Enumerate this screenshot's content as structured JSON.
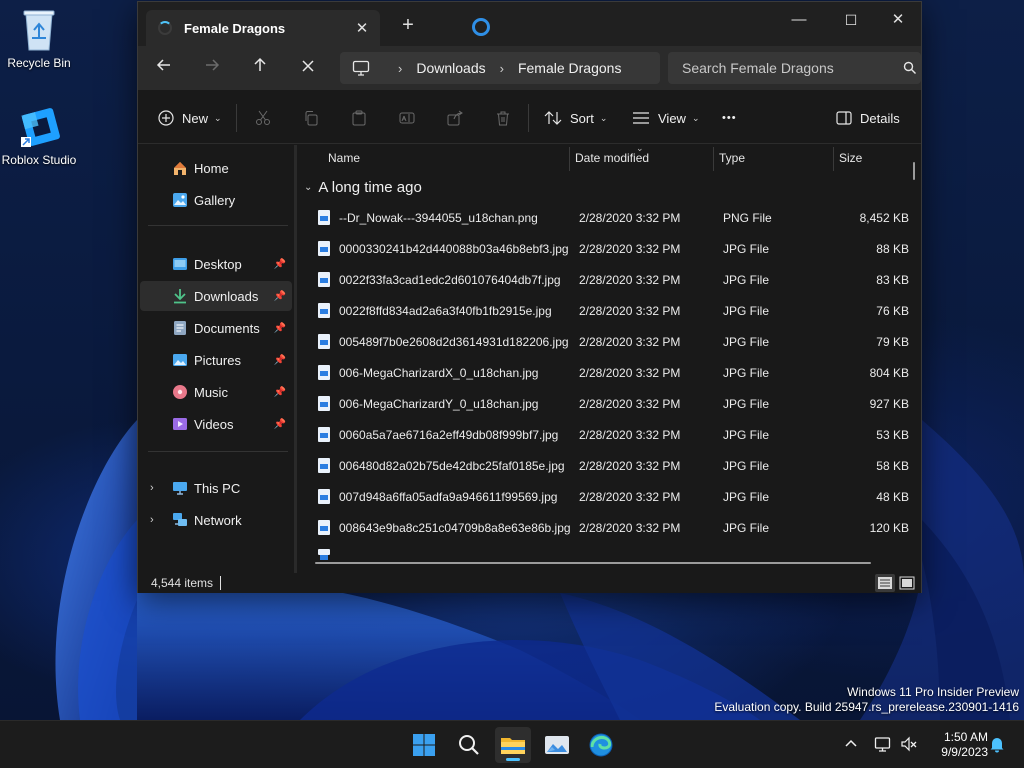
{
  "desktop": {
    "icons": [
      {
        "label": "Recycle Bin",
        "icon": "recycle-bin-icon"
      },
      {
        "label": "Roblox Studio",
        "icon": "roblox-studio-icon"
      }
    ]
  },
  "window": {
    "tab_title": "Female Dragons",
    "tab_close": "✕",
    "new_tab": "+",
    "controls": {
      "minimize": "—",
      "maximize": "☐",
      "close": "✕"
    },
    "breadcrumbs": [
      "Downloads",
      "Female Dragons"
    ],
    "breadcrumb_sep": "›",
    "search_placeholder": "Search Female Dragons",
    "toolbar": {
      "new_label": "New",
      "sort_label": "Sort",
      "view_label": "View",
      "more_label": "•••",
      "details_label": "Details"
    },
    "nav": {
      "home": "Home",
      "gallery": "Gallery",
      "desktop": "Desktop",
      "downloads": "Downloads",
      "documents": "Documents",
      "pictures": "Pictures",
      "music": "Music",
      "videos": "Videos",
      "this_pc": "This PC",
      "network": "Network"
    },
    "columns": {
      "name": "Name",
      "date": "Date modified",
      "type": "Type",
      "size": "Size"
    },
    "group_header": "A long time ago",
    "files": [
      {
        "name": "--Dr_Nowak---3944055_u18chan.png",
        "date": "2/28/2020 3:32 PM",
        "type": "PNG File",
        "size": "8,452 KB"
      },
      {
        "name": "0000330241b42d440088b03a46b8ebf3.jpg",
        "date": "2/28/2020 3:32 PM",
        "type": "JPG File",
        "size": "88 KB"
      },
      {
        "name": "0022f33fa3cad1edc2d601076404db7f.jpg",
        "date": "2/28/2020 3:32 PM",
        "type": "JPG File",
        "size": "83 KB"
      },
      {
        "name": "0022f8ffd834ad2a6a3f40fb1fb2915e.jpg",
        "date": "2/28/2020 3:32 PM",
        "type": "JPG File",
        "size": "76 KB"
      },
      {
        "name": "005489f7b0e2608d2d3614931d182206.jpg",
        "date": "2/28/2020 3:32 PM",
        "type": "JPG File",
        "size": "79 KB"
      },
      {
        "name": "006-MegaCharizardX_0_u18chan.jpg",
        "date": "2/28/2020 3:32 PM",
        "type": "JPG File",
        "size": "804 KB"
      },
      {
        "name": "006-MegaCharizardY_0_u18chan.jpg",
        "date": "2/28/2020 3:32 PM",
        "type": "JPG File",
        "size": "927 KB"
      },
      {
        "name": "0060a5a7ae6716a2eff49db08f999bf7.jpg",
        "date": "2/28/2020 3:32 PM",
        "type": "JPG File",
        "size": "53 KB"
      },
      {
        "name": "006480d82a02b75de42dbc25faf0185e.jpg",
        "date": "2/28/2020 3:32 PM",
        "type": "JPG File",
        "size": "58 KB"
      },
      {
        "name": "007d948a6ffa05adfa9a946611f99569.jpg",
        "date": "2/28/2020 3:32 PM",
        "type": "JPG File",
        "size": "48 KB"
      },
      {
        "name": "008643e9ba8c251c04709b8a8e63e86b.jpg",
        "date": "2/28/2020 3:32 PM",
        "type": "JPG File",
        "size": "120 KB"
      }
    ],
    "status": {
      "item_count": "4,544 items"
    }
  },
  "watermark": {
    "line1": "Windows 11 Pro Insider Preview",
    "line2": "Evaluation copy. Build 25947.rs_prerelease.230901-1416"
  },
  "taskbar": {
    "apps": [
      "start-icon",
      "search-icon",
      "file-explorer-icon",
      "photos-icon",
      "edge-icon"
    ],
    "time": "1:50 AM",
    "date": "9/9/2023"
  },
  "colors": {
    "accent": "#4cc2ff",
    "window_bg": "#191919",
    "taskbar_bg": "#1c1c1c"
  }
}
